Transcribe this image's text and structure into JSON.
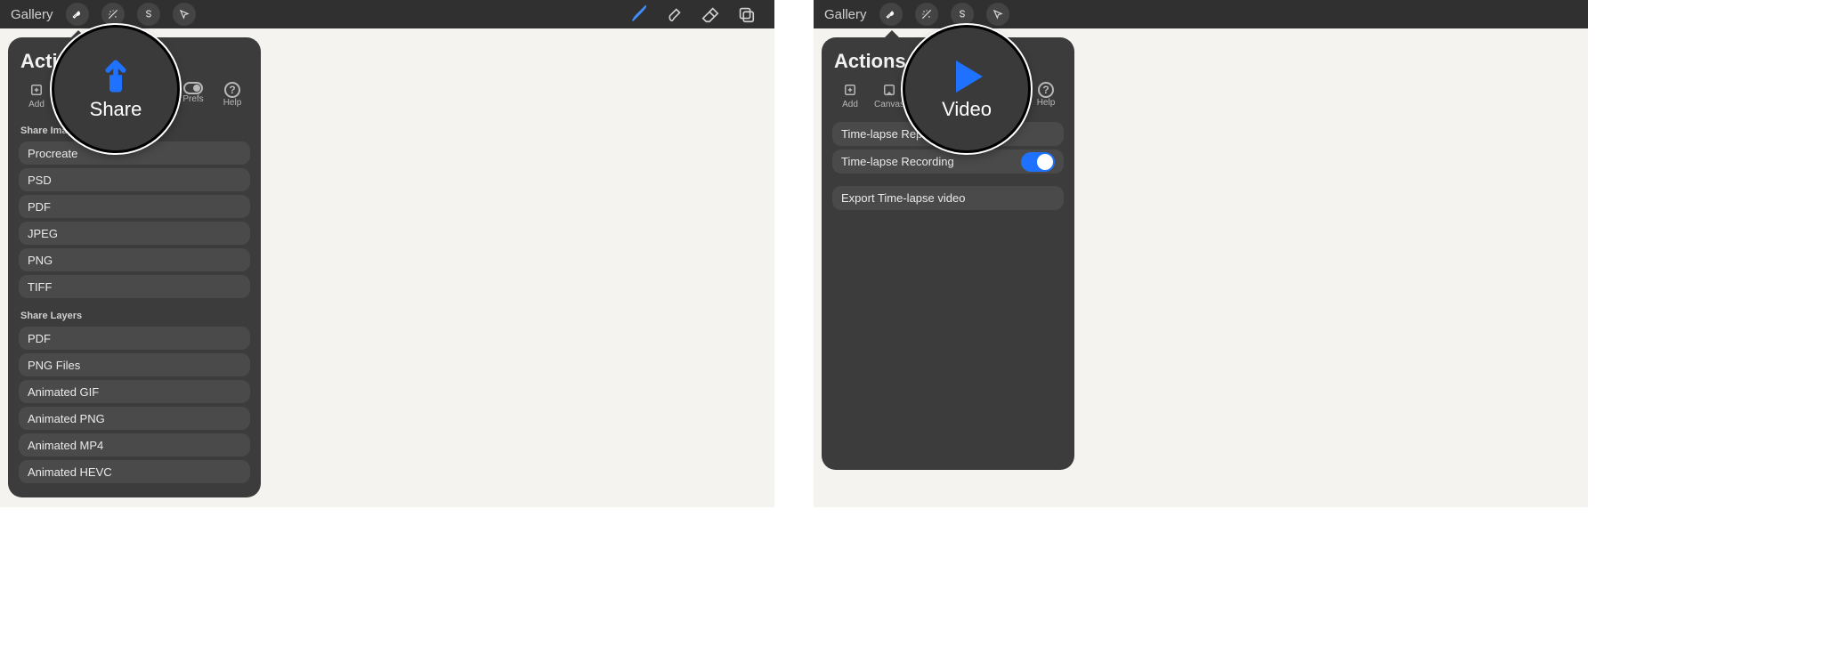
{
  "topbar": {
    "gallery": "Gallery"
  },
  "panelLeft": {
    "title": "Actions",
    "tabs": {
      "add": "Add",
      "canvas": "Canvas",
      "share": "Share",
      "video": "Video",
      "prefs": "Prefs",
      "help": "Help"
    },
    "shareImageHeader": "Share Image",
    "shareImageItems": [
      "Procreate",
      "PSD",
      "PDF",
      "JPEG",
      "PNG",
      "TIFF"
    ],
    "shareLayersHeader": "Share Layers",
    "shareLayersItems": [
      "PDF",
      "PNG Files",
      "Animated GIF",
      "Animated PNG",
      "Animated MP4",
      "Animated HEVC"
    ]
  },
  "calloutLeft": {
    "label": "Share"
  },
  "panelRight": {
    "title": "Actions",
    "tabs": {
      "add": "Add",
      "canvas": "Canvas",
      "share": "Share",
      "video": "Video",
      "prefs": "Prefs",
      "help": "Help"
    },
    "videoItems": {
      "replay": "Time-lapse Replay",
      "recording": "Time-lapse Recording",
      "export": "Export Time-lapse video"
    },
    "recordingOn": true
  },
  "calloutRight": {
    "label": "Video"
  },
  "colors": {
    "accent": "#1f72ff",
    "panelBg": "#3c3c3c",
    "rowBg": "#4a4a4a"
  }
}
